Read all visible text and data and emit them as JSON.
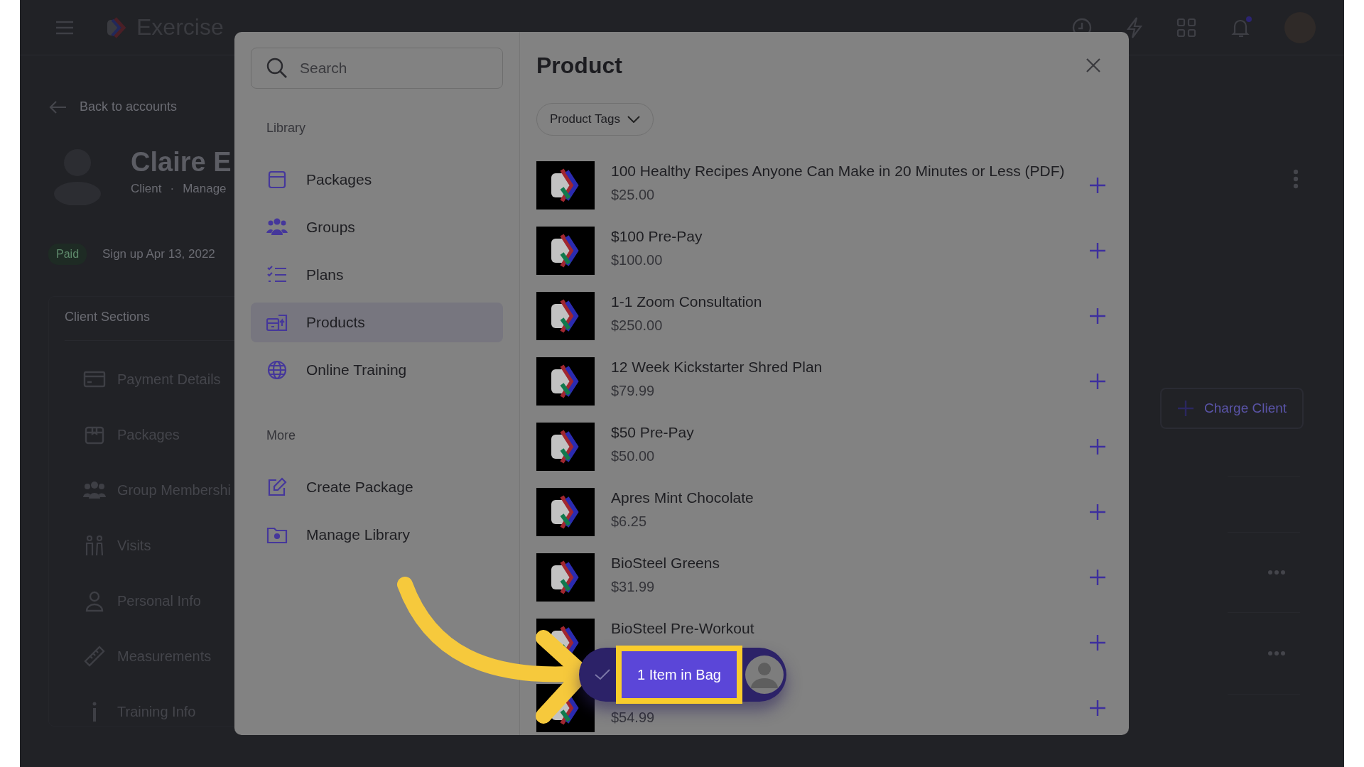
{
  "app": {
    "brand": "Exercise"
  },
  "back_link": "Back to accounts",
  "client": {
    "name": "Claire E",
    "role": "Client",
    "separator": "·",
    "manage": "Manage",
    "status": "Paid",
    "signup": "Sign up Apr 13, 2022"
  },
  "client_sections": {
    "title": "Client Sections",
    "items": [
      {
        "label": "Payment Details",
        "kind": "card"
      },
      {
        "label": "Packages",
        "kind": "box"
      },
      {
        "label": "Group Membershi",
        "kind": "people"
      },
      {
        "label": "Visits",
        "kind": "family"
      },
      {
        "label": "Personal Info",
        "kind": "person"
      },
      {
        "label": "Measurements",
        "kind": "ruler"
      },
      {
        "label": "Training Info",
        "kind": "info"
      }
    ]
  },
  "charge_button": "Charge Client",
  "modal": {
    "search_placeholder": "Search",
    "sections": [
      {
        "title": "Library",
        "items": [
          {
            "label": "Packages",
            "kind": "box",
            "selected": false
          },
          {
            "label": "Groups",
            "kind": "people",
            "selected": false
          },
          {
            "label": "Plans",
            "kind": "checklist",
            "selected": false
          },
          {
            "label": "Products",
            "kind": "store",
            "selected": true
          },
          {
            "label": "Online Training",
            "kind": "globe",
            "selected": false
          }
        ]
      },
      {
        "title": "More",
        "items": [
          {
            "label": "Create Package",
            "kind": "edit",
            "selected": false
          },
          {
            "label": "Manage Library",
            "kind": "folder",
            "selected": false
          }
        ]
      }
    ],
    "title": "Product",
    "filter": "Product Tags",
    "products": [
      {
        "name": "100 Healthy Recipes Anyone Can Make in 20 Minutes or Less (PDF)",
        "price": "$25.00"
      },
      {
        "name": "$100 Pre-Pay",
        "price": "$100.00"
      },
      {
        "name": "1-1 Zoom Consultation",
        "price": "$250.00"
      },
      {
        "name": "12 Week Kickstarter Shred Plan",
        "price": "$79.99"
      },
      {
        "name": "$50 Pre-Pay",
        "price": "$50.00"
      },
      {
        "name": "Apres Mint Chocolate",
        "price": "$6.25"
      },
      {
        "name": "BioSteel Greens",
        "price": "$31.99"
      },
      {
        "name": "BioSteel Pre-Workout"
      },
      {
        "price": "$54.99"
      }
    ]
  },
  "bag": {
    "label": "1 Item in Bag"
  }
}
